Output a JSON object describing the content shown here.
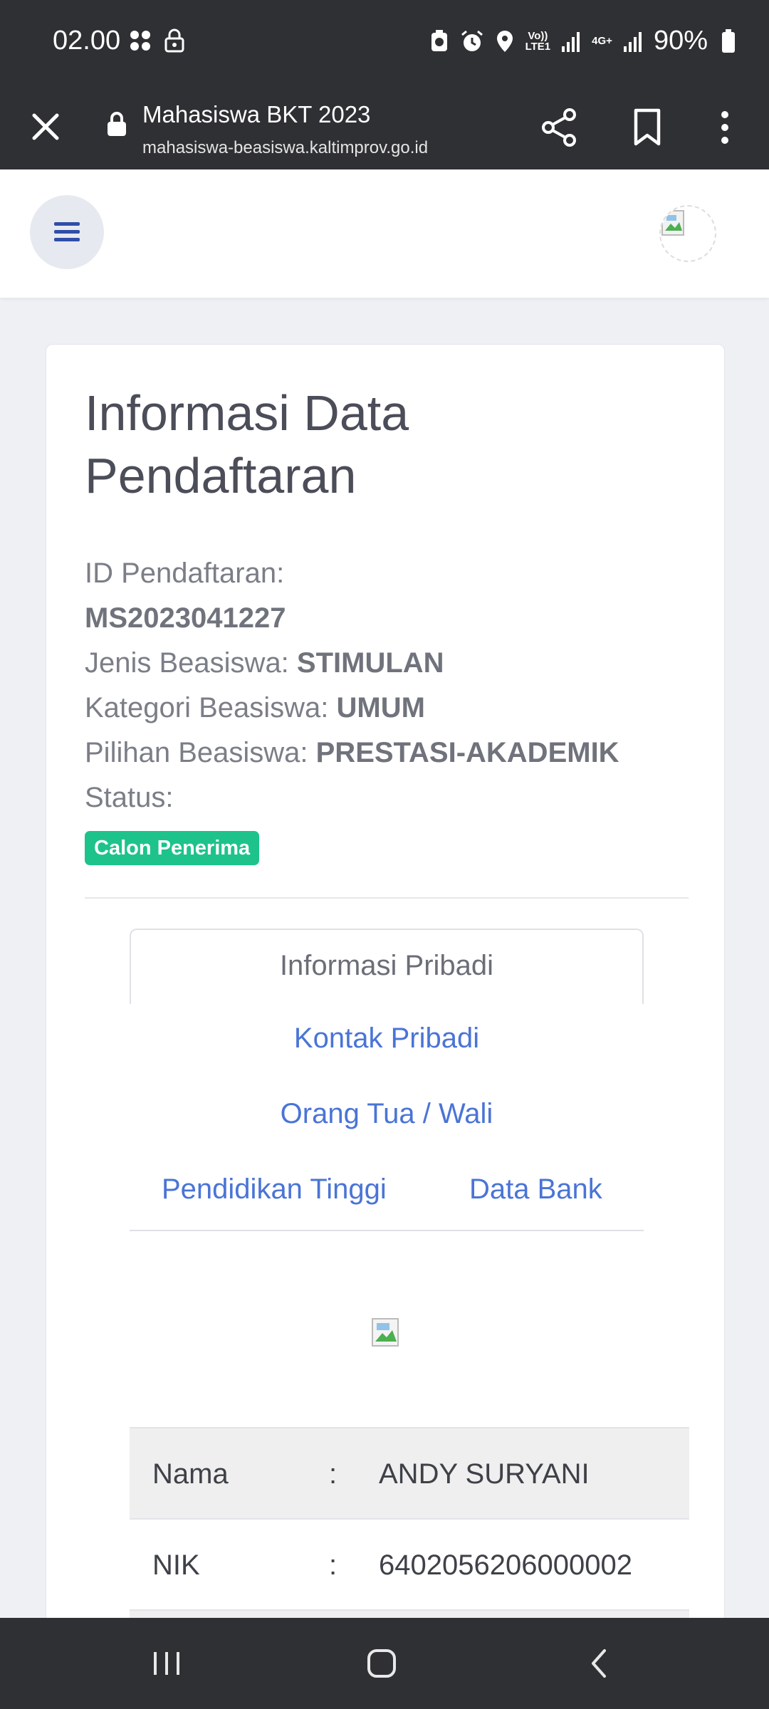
{
  "status_bar": {
    "time": "02.00",
    "battery": "90%",
    "network_label_1": "Vo))\nLTE1",
    "network_label_2": "4G+"
  },
  "browser": {
    "title": "Mahasiswa BKT 2023",
    "url": "mahasiswa-beasiswa.kaltimprov.go.id"
  },
  "card": {
    "title": "Informasi Data Pendaftaran",
    "id_label": "ID Pendaftaran:",
    "id_value": "MS2023041227",
    "jenis_label": "Jenis Beasiswa:",
    "jenis_value": "STIMULAN",
    "kategori_label": "Kategori Beasiswa:",
    "kategori_value": "UMUM",
    "pilihan_label": "Pilihan Beasiswa:",
    "pilihan_value": "PRESTASI-AKADEMIK",
    "status_label": "Status:",
    "status_badge": "Calon Penerima",
    "status_color": "#1dc38b"
  },
  "tabs": {
    "active": "Informasi Pribadi",
    "kontak": "Kontak Pribadi",
    "orang_tua": "Orang Tua / Wali",
    "pendidikan": "Pendidikan Tinggi",
    "bank": "Data Bank",
    "link_color": "#4a74d6"
  },
  "table": {
    "rows": [
      {
        "key": "Nama",
        "sep": ":",
        "value": "ANDY SURYANI"
      },
      {
        "key": "NIK",
        "sep": ":",
        "value": "6402056206000002"
      }
    ]
  },
  "icons": [
    "close-icon",
    "lock-icon",
    "share-icon",
    "bookmark-icon",
    "more-vert-icon",
    "hamburger-menu-icon",
    "recent-apps-icon",
    "home-icon",
    "back-icon"
  ]
}
